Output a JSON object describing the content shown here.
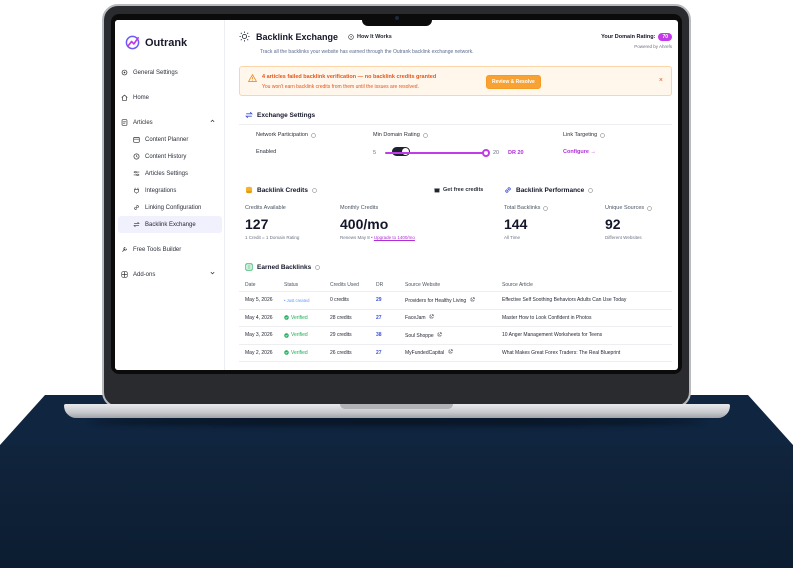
{
  "app": {
    "brand": "Outrank",
    "colors": {
      "accent": "#c13be6",
      "link": "#3b4ed6",
      "warning": "#e4561b",
      "success": "#1fae5b",
      "stage": "#0f2540"
    }
  },
  "sidebar": {
    "items": [
      {
        "label": "General Settings",
        "icon": "gear-icon"
      },
      {
        "label": "Home",
        "icon": "home-icon"
      },
      {
        "label": "Articles",
        "icon": "articles-icon"
      },
      {
        "label": "Content Planner",
        "icon": "calendar-icon"
      },
      {
        "label": "Content History",
        "icon": "history-icon"
      },
      {
        "label": "Articles Settings",
        "icon": "sliders-icon"
      },
      {
        "label": "Integrations",
        "icon": "plug-icon"
      },
      {
        "label": "Linking Configuration",
        "icon": "link-icon"
      },
      {
        "label": "Backlink Exchange",
        "icon": "exchange-icon"
      },
      {
        "label": "Free Tools Builder",
        "icon": "tools-icon"
      },
      {
        "label": "Add-ons",
        "icon": "addons-icon"
      }
    ]
  },
  "header": {
    "title": "Backlink Exchange",
    "how_it_works": "How It Works",
    "subtitle": "Track all the backlinks your website has earned through the Outrank backlink exchange network.",
    "domain_rating_label": "Your Domain Rating:",
    "domain_rating_value": "70",
    "powered_by": "Powered by Ahrefs"
  },
  "alert": {
    "title": "4 articles failed backlink verification — no backlink credits granted",
    "subtitle": "You won't earn backlink credits from them until the issues are resolved.",
    "button": "Review & Resolve",
    "close": "×"
  },
  "exchange": {
    "title": "Exchange Settings",
    "participation_label": "Network Participation",
    "participation_value": "Enabled",
    "min_dr_label": "Min Domain Rating",
    "min_dr_min": "5",
    "min_dr_max": "20",
    "min_dr_value": "DR 20",
    "min_dr_fraction": 1.0,
    "targeting_label": "Link Targeting",
    "targeting_value": "Configure →"
  },
  "credits": {
    "title": "Backlink Credits",
    "get_free": "Get free credits",
    "available_label": "Credits Available",
    "available_value": "127",
    "available_sub": "1 Credit = 1 Domain Rating",
    "monthly_label": "Monthly Credits",
    "monthly_value": "400/mo",
    "monthly_sub": "Renews May 8 •",
    "monthly_upgrade": "Upgrade to 1400/mo"
  },
  "performance": {
    "title": "Backlink Performance",
    "total_label": "Total Backlinks",
    "total_value": "144",
    "total_sub": "All Time",
    "sources_label": "Unique Sources",
    "sources_value": "92",
    "sources_sub": "Different Websites"
  },
  "earned": {
    "title": "Earned Backlinks",
    "headers": [
      "Date",
      "Status",
      "Credits Used",
      "DR",
      "Source Website",
      "Source Article"
    ],
    "rows": [
      {
        "date": "May 5, 2026",
        "status": "Just created",
        "credits": "0 credits",
        "dr": "29",
        "source": "Providers for Healthy Living",
        "article": "Effective Self Soothing Behaviors Adults Can Use Today"
      },
      {
        "date": "May 4, 2026",
        "status": "Verified",
        "credits": "28 credits",
        "dr": "27",
        "source": "FaceJam",
        "article": "Master How to Look Confident in Photos"
      },
      {
        "date": "May 3, 2026",
        "status": "Verified",
        "credits": "29 credits",
        "dr": "38",
        "source": "Soul Shoppe",
        "article": "10 Anger Management Worksheets for Teens"
      },
      {
        "date": "May 2, 2026",
        "status": "Verified",
        "credits": "26 credits",
        "dr": "27",
        "source": "MyFundedCapital",
        "article": "What Makes Great Forex Traders: The Real Blueprint"
      }
    ]
  }
}
